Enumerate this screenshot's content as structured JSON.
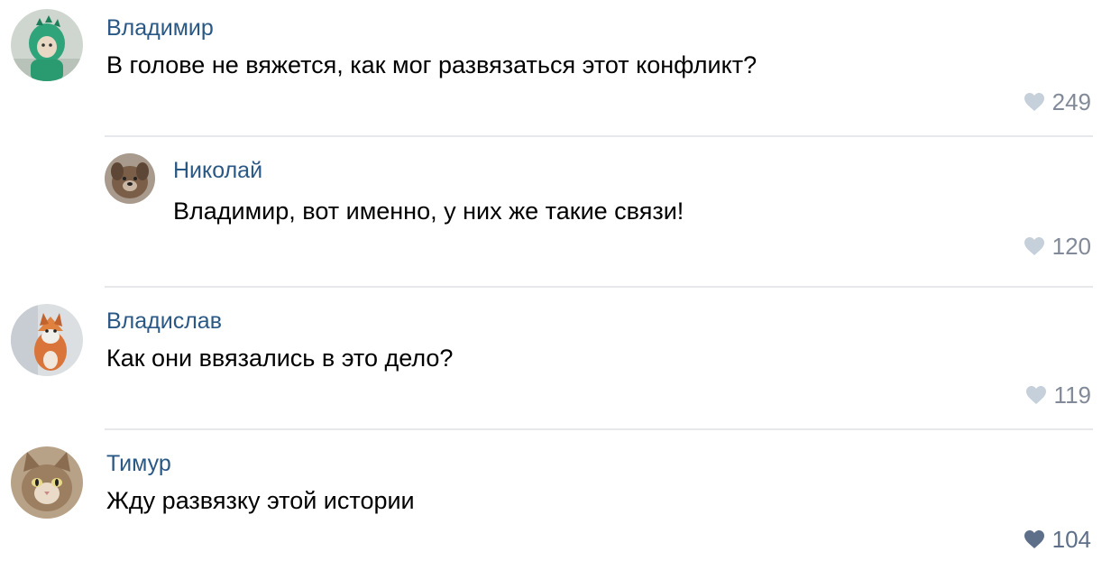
{
  "comments": [
    {
      "author": "Владимир",
      "text": "В голове не вяжется, как мог развязаться этот конфликт?",
      "likes": "249",
      "avatar_icon": "dinosaur-costume-avatar",
      "liked": false
    },
    {
      "author": "Николай",
      "text": "Владимир, вот именно, у них же такие связи!",
      "likes": "120",
      "avatar_icon": "dog-avatar",
      "liked": false,
      "reply": true
    },
    {
      "author": "Владислав",
      "text": "Как они ввязались в это дело?",
      "likes": "119",
      "avatar_icon": "fox-avatar",
      "liked": false
    },
    {
      "author": "Тимур",
      "text": "Жду развязку этой истории",
      "likes": "104",
      "avatar_icon": "cat-avatar",
      "liked": true
    }
  ],
  "colors": {
    "author": "#2a5885",
    "text": "#000000",
    "like_count": "#828a99",
    "heart_inactive": "#c5d0db",
    "heart_active": "#5d6f89",
    "divider": "#e7e8ec"
  }
}
